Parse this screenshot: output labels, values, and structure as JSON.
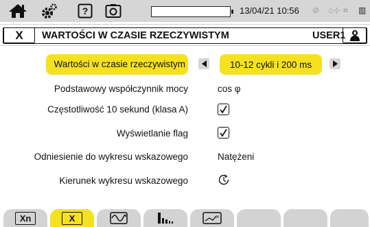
{
  "status_bar": {
    "icons": [
      "home-icon",
      "settings-icon",
      "help-icon",
      "camera-icon",
      "battery-icon",
      "recording-icon",
      "usb-icon",
      "sd-card-icon"
    ],
    "help_glyph": "?",
    "datetime": "13/04/21 10:56"
  },
  "header": {
    "close_label": "X",
    "title": "WARTOŚCI W CZASIE RZECZYWISTYM",
    "user": "USER1"
  },
  "settings": {
    "realtime": {
      "label": "Wartości w czasie rzeczywistym",
      "value": "10-12 cykli i 200 ms"
    },
    "power_factor": {
      "label": "Podstawowy współczynnik mocy",
      "value": "cos φ"
    },
    "frequency_10s": {
      "label": "Częstotliwość 10 sekund (klasa A)",
      "checked": true
    },
    "flags": {
      "label": "Wyświetlanie flag",
      "checked": true
    },
    "phasor_ref": {
      "label": "Odniesienie do wykresu wskazowego",
      "value": "Natężeni"
    },
    "phasor_dir": {
      "label": "Kierunek wykresu wskazowego",
      "icon": "counterclockwise-rotation-icon"
    }
  },
  "tabs": [
    {
      "label": "Xn",
      "active": false
    },
    {
      "label": "X",
      "active": true
    },
    {
      "icon": "waveform-icon",
      "active": false
    },
    {
      "icon": "harmonics-icon",
      "active": false
    },
    {
      "icon": "trend-icon",
      "active": false
    },
    {
      "label": "",
      "active": false
    },
    {
      "label": "",
      "active": false
    },
    {
      "label": "",
      "active": false
    }
  ],
  "colors": {
    "highlight": "#f5e11f",
    "bar_gray": "#d6d6d6"
  }
}
